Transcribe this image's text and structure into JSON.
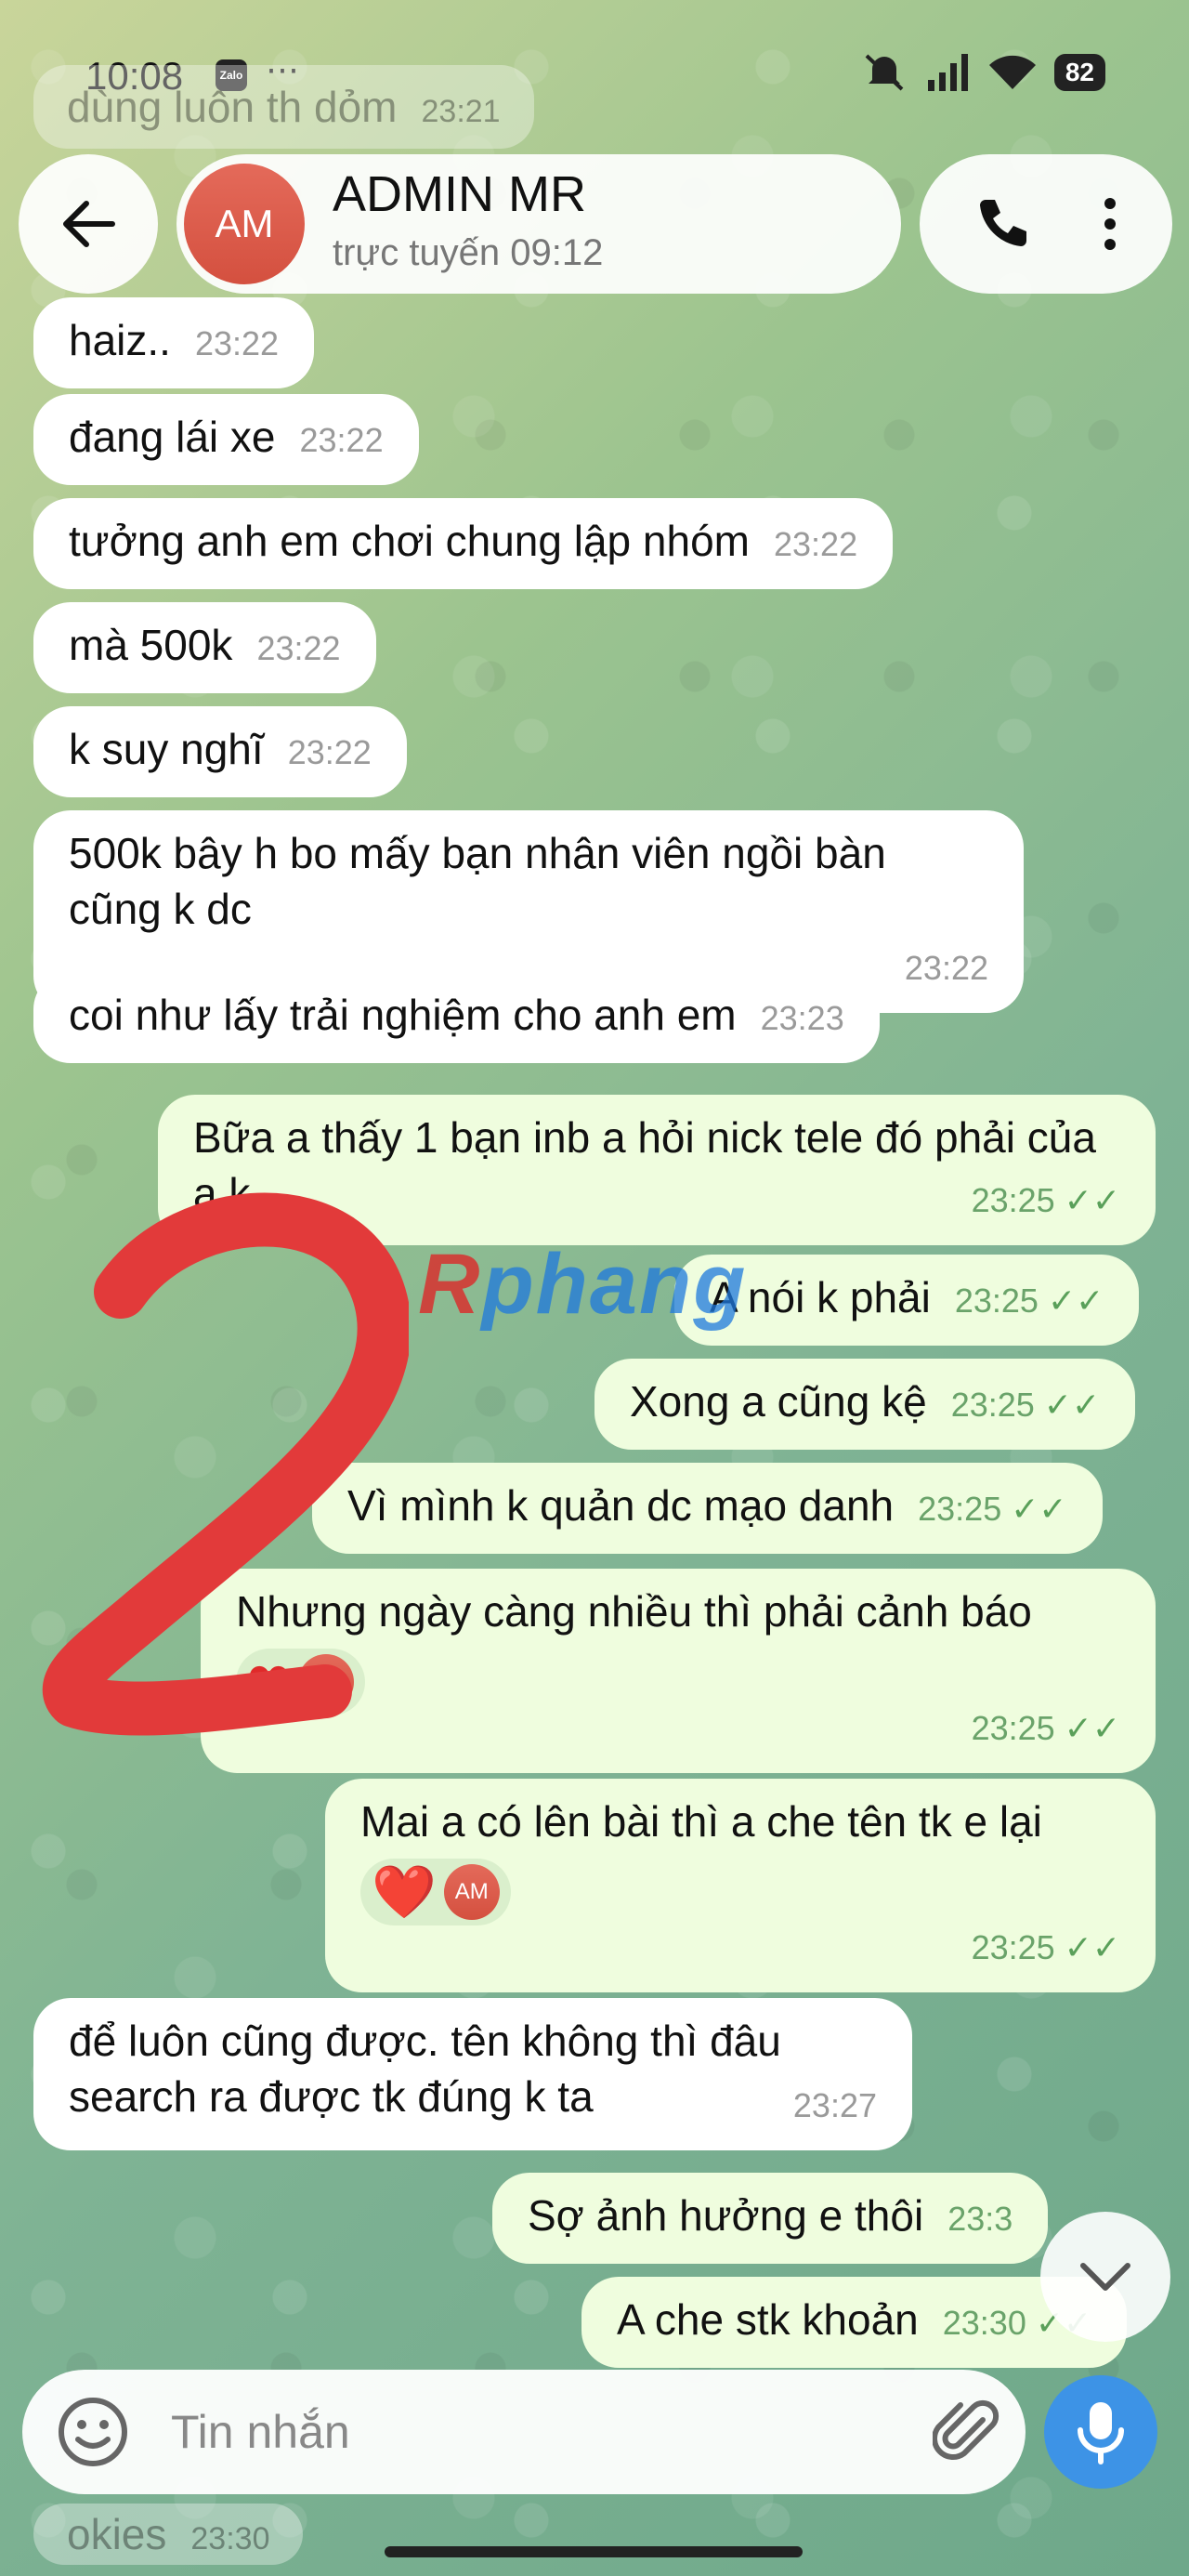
{
  "status_bar": {
    "time": "10:08",
    "zalo_label": "Zalo",
    "battery": "82"
  },
  "ghost_messages": [
    {
      "text": "dùng luôn th dỏm",
      "time": "23:21"
    },
    {
      "text": "okies",
      "time": "23:30"
    }
  ],
  "header": {
    "avatar_initials": "AM",
    "name": "ADMIN MR",
    "status": "trực tuyến 09:12"
  },
  "messages": [
    {
      "text": "haiz..",
      "time": "23:22"
    },
    {
      "text": "đang lái xe",
      "time": "23:22"
    },
    {
      "text": "tưởng anh em chơi chung lập nhóm",
      "time": "23:22"
    },
    {
      "text": "mà 500k",
      "time": "23:22"
    },
    {
      "text": "k suy nghĩ",
      "time": "23:22"
    },
    {
      "text": "500k bây h bo mấy bạn nhân viên ngồi bàn cũng k dc",
      "time": "23:22"
    },
    {
      "text": "coi như lấy trải nghiệm cho anh em",
      "time": "23:23"
    },
    {
      "text": "Bữa a thấy 1 bạn inb a hỏi nick tele đó phải của a k",
      "time": "23:25"
    },
    {
      "text": "A nói k phải",
      "time": "23:25"
    },
    {
      "text": "Xong a cũng kệ",
      "time": "23:25"
    },
    {
      "text": "Vì mình k quản dc mạo danh",
      "time": "23:25"
    },
    {
      "text": "Nhưng ngày càng nhiều thì phải cảnh báo",
      "time": "23:25",
      "reaction_avatar": "AM"
    },
    {
      "text": "Mai a có lên bài thì a che tên tk e lại",
      "time": "23:25",
      "reaction": "❤️",
      "reaction_avatar": "AM"
    },
    {
      "text": "để luôn cũng được. tên không thì đâu search ra được tk đúng k ta",
      "time": "23:27"
    },
    {
      "text": "Sợ ảnh hưởng e thôi",
      "time": "23:3"
    },
    {
      "text": "A che stk khoản",
      "time": "23:30"
    }
  ],
  "overlay": {
    "watermark_a": "R",
    "watermark_b": "phang",
    "handwritten": "2"
  },
  "composer": {
    "placeholder": "Tin nhắn"
  },
  "colors": {
    "outgoing_bubble": "#effdde",
    "incoming_bubble": "#ffffff",
    "accent": "#3d93e6",
    "avatar": "#d4503f"
  }
}
